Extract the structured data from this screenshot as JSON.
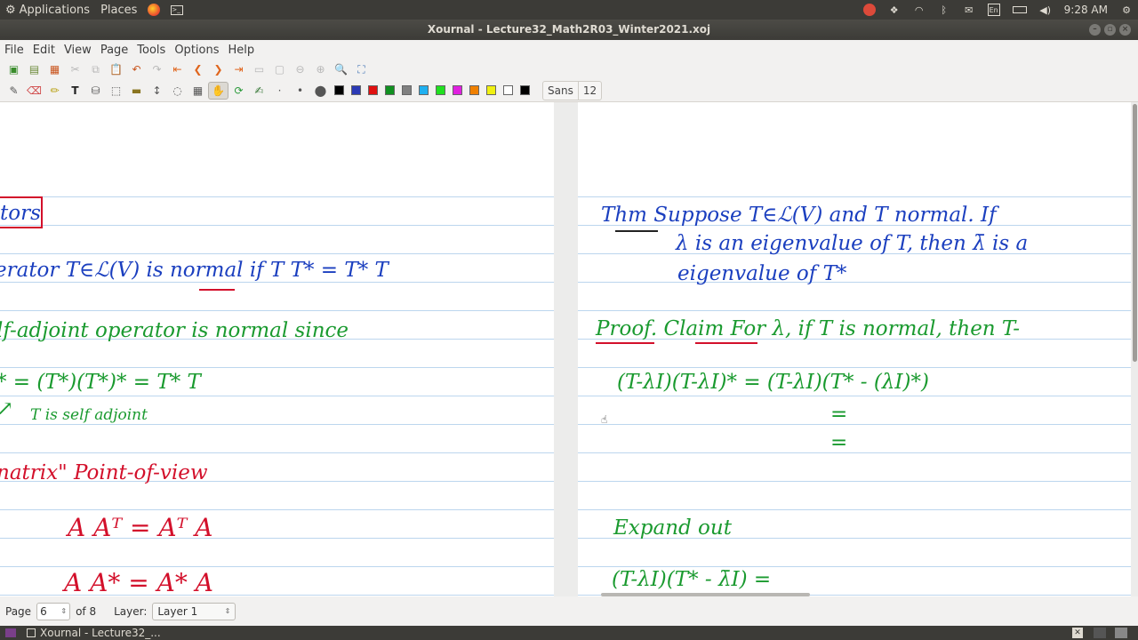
{
  "top_panel": {
    "applications": "Applications",
    "places": "Places",
    "time": "9:28 AM",
    "keyboard": "En"
  },
  "window": {
    "title": "Xournal - Lecture32_Math2R03_Winter2021.xoj"
  },
  "menubar": [
    "File",
    "Edit",
    "View",
    "Page",
    "Tools",
    "Options",
    "Help"
  ],
  "toolbar2": {
    "colors": [
      "#000000",
      "#2b3ab5",
      "#e01010",
      "#109020",
      "#808080",
      "#20b0f0",
      "#20e020",
      "#e020e0",
      "#f08000",
      "#f0f010",
      "#ffffff",
      "#000000"
    ],
    "font_name": "Sans",
    "font_size": "12"
  },
  "left_page": {
    "box_label": "tors",
    "line1": "erator  T∈ℒ(V) is normal if  T T* = T* T",
    "line2": "lf-adjoint  operator is normal since",
    "line3": "* = (T*)(T*)* = T* T",
    "line4": "T is self adjoint",
    "line5": "natrix\"  Point-of-view",
    "line6": "A Aᵀ = Aᵀ A",
    "line7": "A A* = A* A"
  },
  "right_page": {
    "thm1": "Thm   Suppose  T∈ℒ(V)  and  T normal.  If",
    "thm2": "λ is an eigenvalue of T,  then  λ̄ is a",
    "thm3": "eigenvalue   of   T*",
    "proof": "Proof.   Claim   For λ, if T is normal, then T-",
    "eq1": "(T-λI)(T-λI)* = (T-λI)(T* - (λI)*)",
    "eq2": "=",
    "eq3": "=",
    "expand": "Expand out",
    "eq4": "(T-λI)(T* - λ̄I) ="
  },
  "statusbar": {
    "page_label": "Page",
    "page_value": "6",
    "of_label": "of 8",
    "layer_label": "Layer:",
    "layer_value": "Layer 1"
  },
  "taskbar": {
    "task_label": "Xournal - Lecture32_..."
  }
}
